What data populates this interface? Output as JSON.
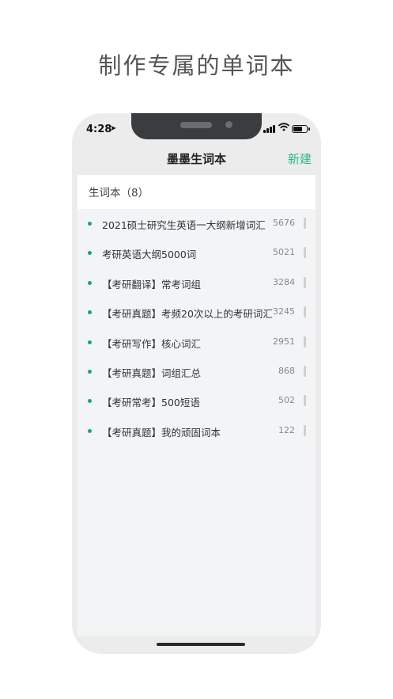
{
  "headline": "制作专属的单词本",
  "status_bar": {
    "time": "4:28",
    "location_icon": "location-arrow-icon",
    "signal_icon": "signal-icon",
    "wifi_icon": "wifi-icon",
    "battery_icon": "battery-icon",
    "battery_level": 0.75
  },
  "nav": {
    "title": "墨墨生词本",
    "new_label": "新建"
  },
  "list_header": "生词本（8）",
  "wordbooks": [
    {
      "title": "2021硕士研究生英语一大纲新增词汇",
      "count": "5676"
    },
    {
      "title": "考研英语大纲5000词",
      "count": "5021"
    },
    {
      "title": "【考研翻译】常考词组",
      "count": "3284"
    },
    {
      "title": "【考研真题】考频20次以上的考研词汇",
      "count": "3245"
    },
    {
      "title": "【考研写作】核心词汇",
      "count": "2951"
    },
    {
      "title": "【考研真题】词组汇总",
      "count": "868"
    },
    {
      "title": "【考研常考】500短语",
      "count": "502"
    },
    {
      "title": "【考研真题】我的顽固词本",
      "count": "122"
    }
  ],
  "colors": {
    "accent": "#2bb38d",
    "dot": "#1aa27c"
  }
}
